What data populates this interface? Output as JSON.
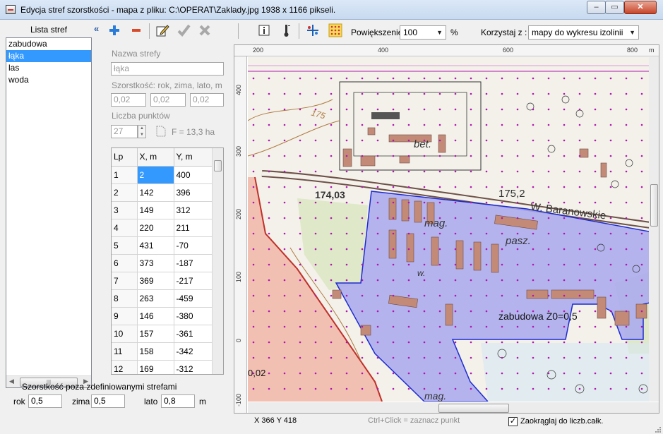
{
  "window": {
    "title": "Edycja stref szorstkości  - mapa z pliku: C:\\OPERAT\\Zaklady.jpg  1938 x 1166 pikseli.",
    "controls": {
      "minimize": "–",
      "maximize": "▭",
      "close": "✕"
    }
  },
  "left_panel": {
    "title": "Lista stref",
    "collapse_symbol": "«",
    "zones": [
      {
        "name": "zabudowa",
        "selected": false
      },
      {
        "name": "łąka",
        "selected": true
      },
      {
        "name": "las",
        "selected": false
      },
      {
        "name": "woda",
        "selected": false
      }
    ]
  },
  "toolbar": {
    "zoom_label": "Powiększenie",
    "zoom_value": "100",
    "zoom_unit": "%",
    "use_label": "Korzystaj z :",
    "use_value": "mapy do wykresu izolinii",
    "icons": [
      "add-icon",
      "remove-icon",
      "edit-icon",
      "accept-icon",
      "cancel-icon",
      "info-icon",
      "thermometer-icon",
      "move-points-icon",
      "grid-points-icon"
    ]
  },
  "form": {
    "name_label": "Nazwa strefy",
    "name_value": "łąka",
    "roughness_label": "Szorstkość: rok, zima, lato, m",
    "roughness_values": [
      "0,02",
      "0,02",
      "0,02"
    ],
    "points_label": "Liczba punktów",
    "points_value": "27",
    "area_text": "F  =  13,3 ha"
  },
  "points_table": {
    "headers": [
      "Lp",
      "X, m",
      "Y, m"
    ],
    "rows": [
      [
        "1",
        "2",
        "400"
      ],
      [
        "2",
        "142",
        "396"
      ],
      [
        "3",
        "149",
        "312"
      ],
      [
        "4",
        "220",
        "211"
      ],
      [
        "5",
        "431",
        "-70"
      ],
      [
        "6",
        "373",
        "-187"
      ],
      [
        "7",
        "369",
        "-217"
      ],
      [
        "8",
        "263",
        "-459"
      ],
      [
        "9",
        "146",
        "-380"
      ],
      [
        "10",
        "157",
        "-361"
      ],
      [
        "11",
        "158",
        "-342"
      ],
      [
        "12",
        "169",
        "-312"
      ]
    ]
  },
  "bottom": {
    "title": "Szorstkość poza zdefiniowanymi strefami",
    "rok_label": "rok",
    "rok_value": "0,5",
    "zima_label": "zima",
    "zima_value": "0,5",
    "lato_label": "lato",
    "lato_value": "0,8",
    "unit": "m"
  },
  "map": {
    "ruler_top": [
      "200",
      "400",
      "600",
      "800"
    ],
    "ruler_top_unit": "m",
    "ruler_left": [
      "400",
      "300",
      "200",
      "100",
      "0",
      "-100"
    ],
    "labels": {
      "height_1": "174,03",
      "height_2": "175,2",
      "street": "W. Baranowskie",
      "mag_1": "mag.",
      "pasz": "pasz.",
      "bet": "bet.",
      "w": "w.",
      "mag_2": "mag.",
      "zone_label": "zabudowa Z0=0,5",
      "z_left": "0,02",
      "contour": "175"
    }
  },
  "status": {
    "coords": "X 366 Y 418",
    "hint": "Ctrl+Click = zaznacz punkt",
    "round_checked": true,
    "round_label": "Zaokrąglaj do liczb.całk."
  }
}
